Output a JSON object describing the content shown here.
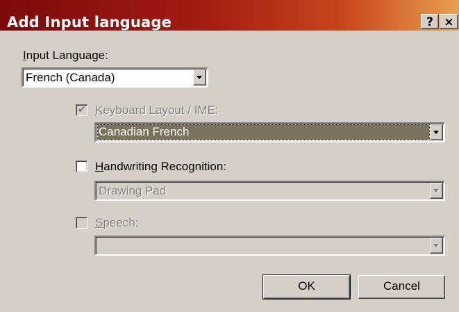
{
  "window": {
    "title": "Add Input language",
    "help_label": "?",
    "close_label": "×"
  },
  "input_language": {
    "label": "Input Language:",
    "value": "French (Canada)"
  },
  "keyboard_layout": {
    "checked": true,
    "enabled": false,
    "label": "Keyboard Layout / IME:",
    "value": "Canadian French"
  },
  "handwriting": {
    "checked": false,
    "enabled": true,
    "label": "Handwriting Recognition:",
    "value": "Drawing Pad"
  },
  "speech": {
    "checked": false,
    "enabled": false,
    "label": "Speech:",
    "value": ""
  },
  "buttons": {
    "ok": "OK",
    "cancel": "Cancel"
  },
  "icons": {
    "dropdown": "chevron-down-icon",
    "checkmark": "checkmark-icon"
  }
}
